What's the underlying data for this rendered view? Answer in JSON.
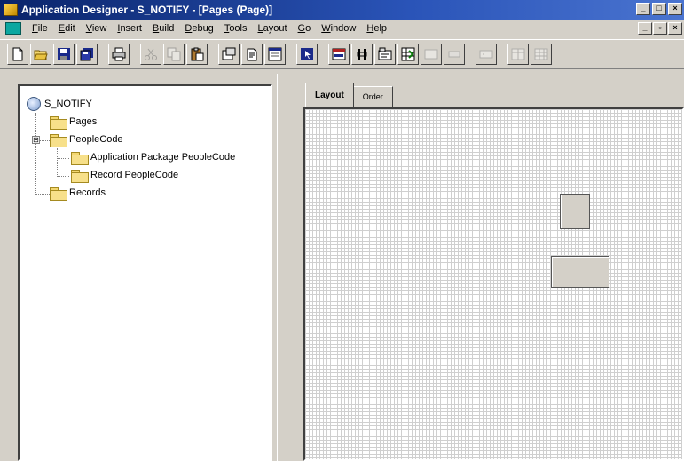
{
  "window": {
    "title": "Application Designer - S_NOTIFY - [Pages (Page)]",
    "controls": [
      "_",
      "□",
      "×"
    ]
  },
  "menu": {
    "items": [
      "File",
      "Edit",
      "View",
      "Insert",
      "Build",
      "Debug",
      "Tools",
      "Layout",
      "Go",
      "Window",
      "Help"
    ],
    "mdi_controls": [
      "_",
      "▫",
      "×"
    ]
  },
  "toolbar": {
    "buttons": [
      "new-icon",
      "open-icon",
      "save-icon",
      "save-all-icon",
      "print-icon",
      "cut-icon",
      "copy-icon",
      "paste-icon",
      "properties-icon",
      "find-icon",
      "project-icon",
      "select-icon",
      "page-field-icon",
      "field-icon",
      "tab-icon",
      "grid-icon",
      "frame-icon",
      "edit-box-icon",
      "scroll-icon",
      "group-box-icon",
      "subpage-icon"
    ]
  },
  "tree": {
    "root": "S_NOTIFY",
    "items": [
      {
        "label": "Pages",
        "level": 1
      },
      {
        "label": "PeopleCode",
        "level": 1,
        "expander": "⊟"
      },
      {
        "label": "Application Package PeopleCode",
        "level": 2
      },
      {
        "label": "Record PeopleCode",
        "level": 2
      },
      {
        "label": "Records",
        "level": 1
      }
    ]
  },
  "tabs": [
    {
      "label": "Layout",
      "active": true
    },
    {
      "label": "Order",
      "active": false
    }
  ],
  "colors": {
    "chrome": "#d4d0c8",
    "title_bar": "#0a246a",
    "grid": "#cfcfcf"
  }
}
